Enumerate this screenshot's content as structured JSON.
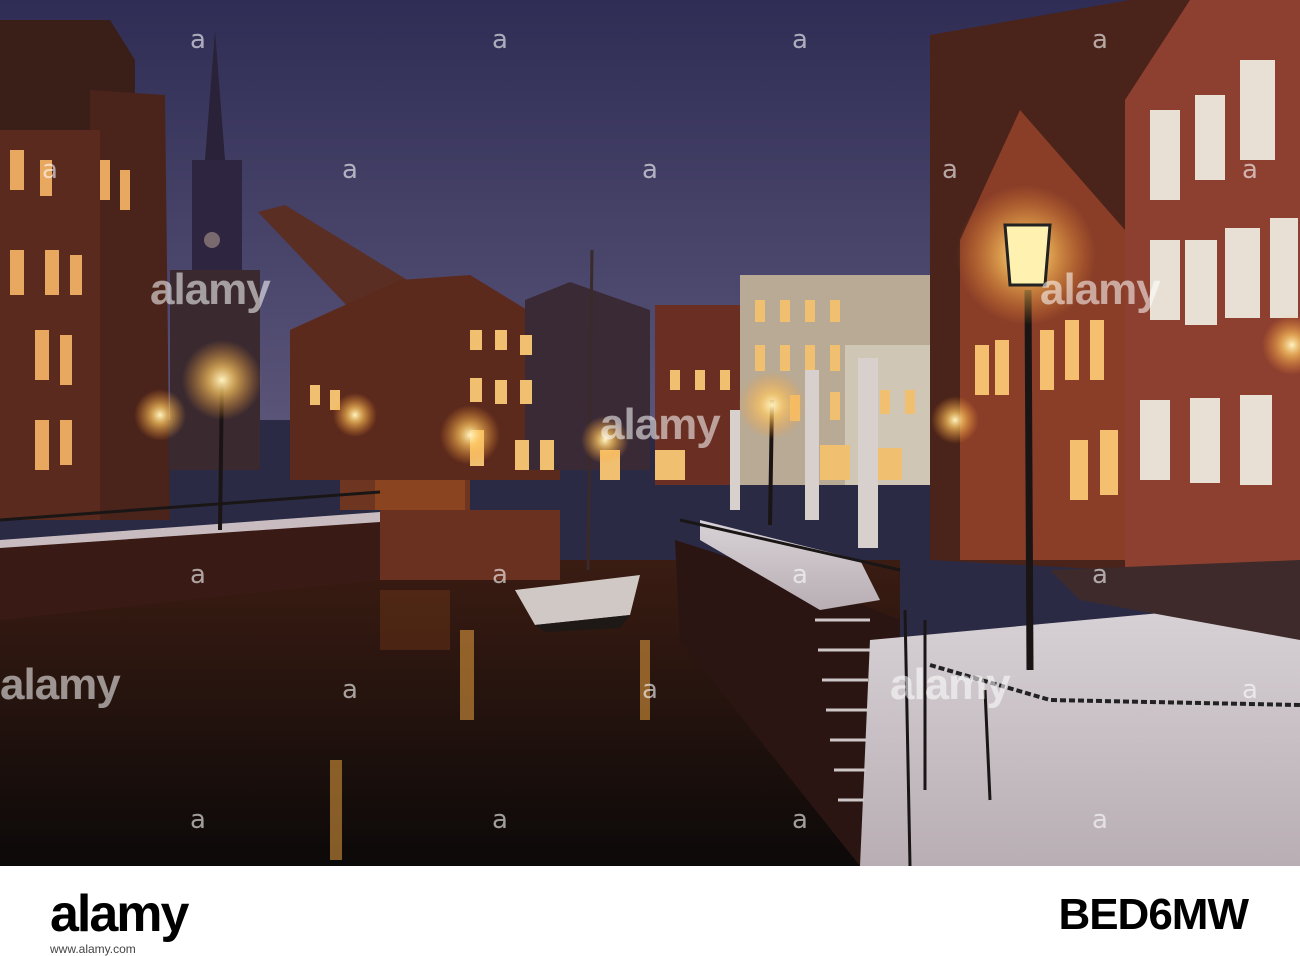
{
  "watermark": {
    "text": "alamy",
    "repeat": "a"
  },
  "footer": {
    "logo": "alamy",
    "url": "www.alamy.com",
    "image_id": "BED6MW"
  },
  "scene": {
    "subject": "Harbour canal at dusk with snow, half-timbered houses, historic wooden crane, sailing boat and lit street lamps",
    "sky_color": "#3d3a63",
    "water_color": "#1a1211",
    "lamp_color": "#ffd27a"
  }
}
